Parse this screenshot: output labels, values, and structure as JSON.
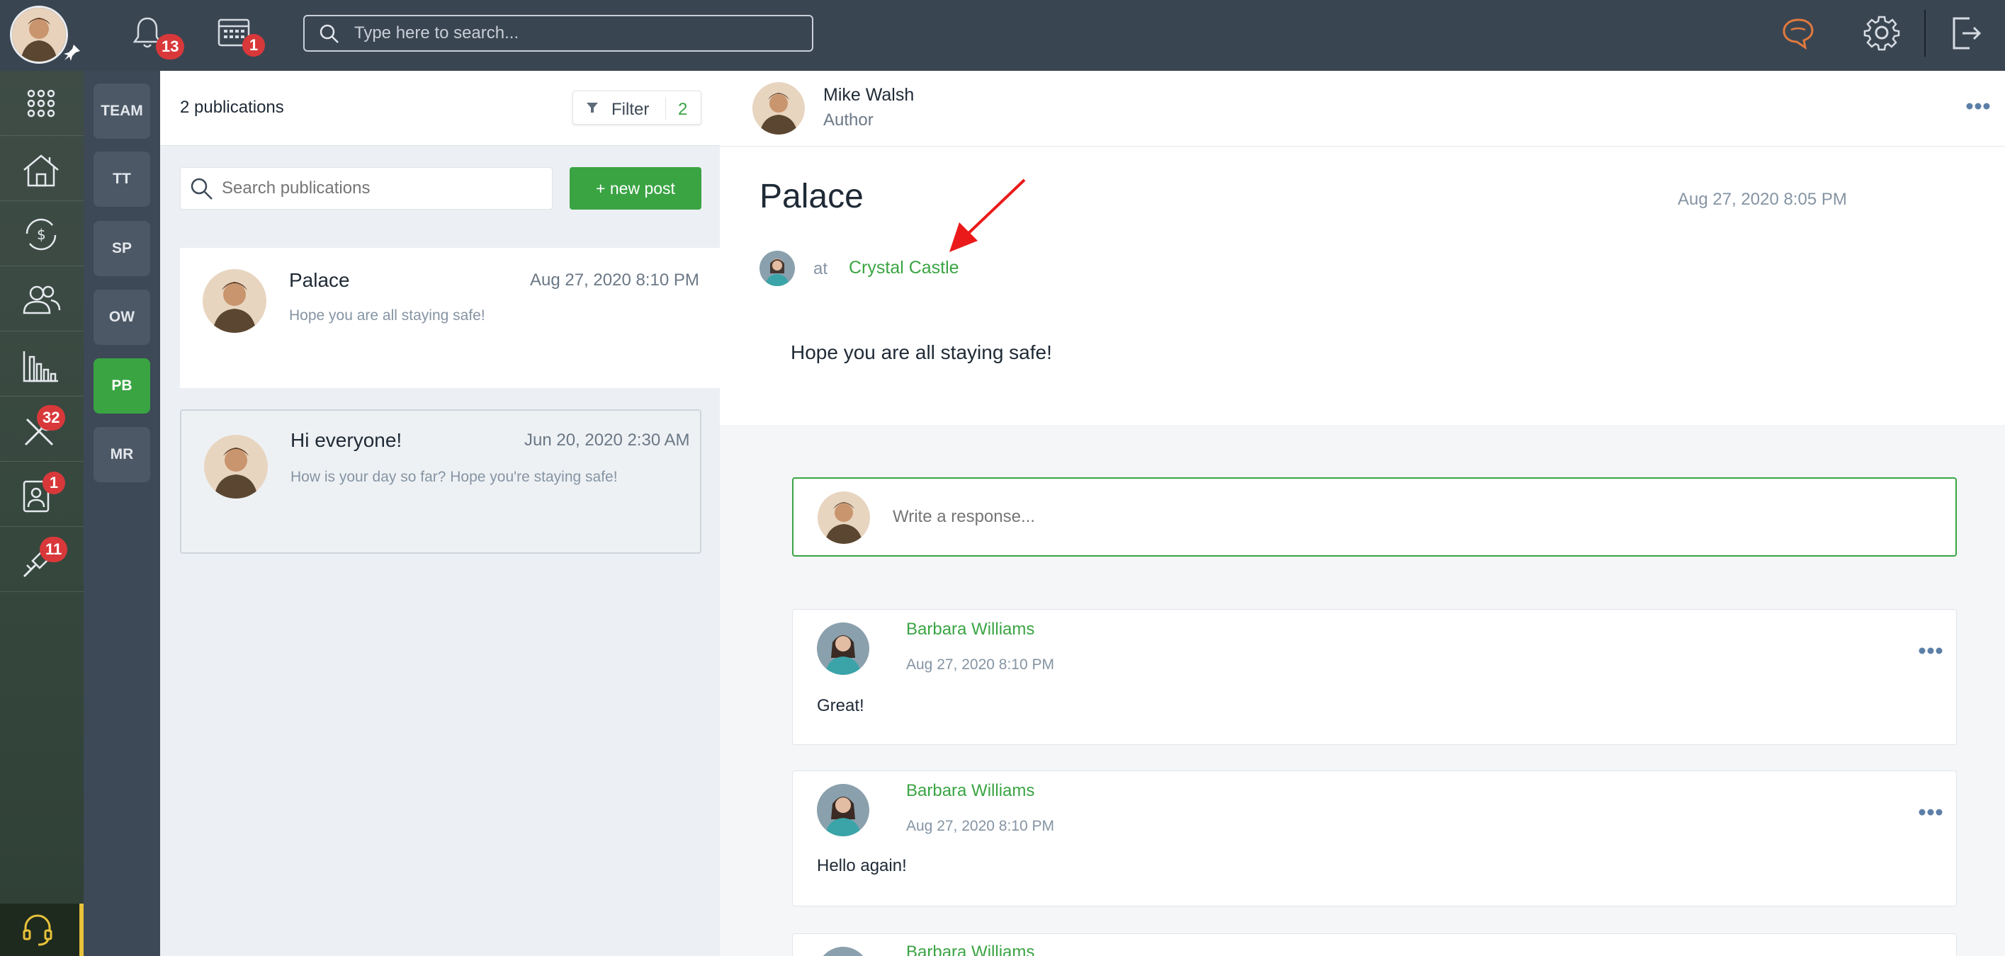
{
  "topbar": {
    "notifications_count": "13",
    "calendar_count": "1",
    "search_placeholder": "Type here to search..."
  },
  "nav": {
    "badges": {
      "tools": "32",
      "contacts": "1",
      "pins": "11"
    },
    "items": [
      "apps-grid-icon",
      "home-icon",
      "finance-icon",
      "people-icon",
      "chart-icon",
      "tools-icon",
      "contact-card-icon",
      "pin-tool-icon"
    ]
  },
  "teams": [
    "TEAM",
    "TT",
    "SP",
    "OW",
    "PB",
    "MR"
  ],
  "active_team": "PB",
  "publications": {
    "count_label": "2 publications",
    "filter_label": "Filter",
    "filter_count": "2",
    "search_placeholder": "Search publications",
    "new_post_label": "+ new post",
    "items": [
      {
        "title": "Palace",
        "date": "Aug 27, 2020 8:10 PM",
        "excerpt": "Hope you are all staying safe!"
      },
      {
        "title": "Hi everyone!",
        "date": "Jun 20, 2020 2:30 AM",
        "excerpt": "How is your day so far? Hope you're staying safe!"
      }
    ]
  },
  "detail": {
    "author_name": "Mike Walsh",
    "author_role": "Author",
    "post_title": "Palace",
    "post_date": "Aug 27, 2020 8:05 PM",
    "at_label": "at",
    "location": "Crystal Castle",
    "body": "Hope you are all staying safe!",
    "response_placeholder": "Write a response...",
    "comments": [
      {
        "author": "Barbara Williams",
        "date": "Aug 27, 2020 8:10 PM",
        "text": "Great!"
      },
      {
        "author": "Barbara Williams",
        "date": "Aug 27, 2020 8:10 PM",
        "text": "Hello again!"
      },
      {
        "author": "Barbara Williams",
        "date": "",
        "text": ""
      }
    ]
  },
  "colors": {
    "accent": "#3aa443",
    "topbar": "#3a4552",
    "badge": "#d9383a",
    "chat_icon": "#e07a3c"
  }
}
